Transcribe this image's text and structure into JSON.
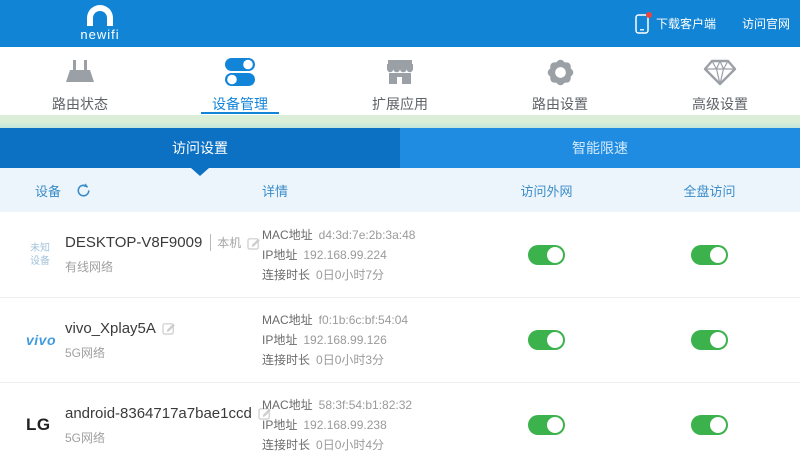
{
  "header": {
    "logo": "newifi",
    "links": [
      {
        "label": "下载客户端",
        "icon": "phone-icon",
        "badge": true
      },
      {
        "label": "访问官网"
      }
    ]
  },
  "nav": {
    "items": [
      {
        "label": "路由状态",
        "icon": "router-icon",
        "active": false
      },
      {
        "label": "设备管理",
        "icon": "toggles-icon",
        "active": true
      },
      {
        "label": "扩展应用",
        "icon": "store-icon",
        "active": false
      },
      {
        "label": "路由设置",
        "icon": "gear-icon",
        "active": false
      },
      {
        "label": "高级设置",
        "icon": "diamond-icon",
        "active": false
      }
    ]
  },
  "tabs": {
    "items": [
      {
        "label": "访问设置",
        "active": true
      },
      {
        "label": "智能限速",
        "active": false
      }
    ]
  },
  "table": {
    "header": {
      "device": "设备",
      "refresh_icon": "refresh-icon",
      "details": "详情",
      "wan": "访问外网",
      "disk": "全盘访问"
    },
    "rows": [
      {
        "brand": "未知设备",
        "name": "DESKTOP-V8F9009",
        "tag": "本机",
        "network": "有线网络",
        "mac_label": "MAC地址",
        "mac": "d4:3d:7e:2b:3a:48",
        "ip_label": "IP地址",
        "ip": "192.168.99.224",
        "duration_label": "连接时长",
        "duration": "0日0小时7分",
        "wan_on": true,
        "disk_on": true
      },
      {
        "brand": "vivo",
        "name": "vivo_Xplay5A",
        "network": "5G网络",
        "mac_label": "MAC地址",
        "mac": "f0:1b:6c:bf:54:04",
        "ip_label": "IP地址",
        "ip": "192.168.99.126",
        "duration_label": "连接时长",
        "duration": "0日0小时3分",
        "wan_on": true,
        "disk_on": true
      },
      {
        "brand": "LG",
        "name": "android-8364717a7bae1ccd",
        "network": "5G网络",
        "mac_label": "MAC地址",
        "mac": "58:3f:54:b1:82:32",
        "ip_label": "IP地址",
        "ip": "192.168.99.238",
        "duration_label": "连接时长",
        "duration": "0日0小时4分",
        "wan_on": true,
        "disk_on": true
      }
    ]
  },
  "colors": {
    "header_bg": "#1184d6",
    "accent_blue": "#1385d8",
    "tab_active": "#0d71c3",
    "tab_inactive": "#1f8ce2",
    "green_strip": "#daeed8",
    "table_header_bg": "#edf5fc",
    "toggle_on": "#3bb24b"
  }
}
